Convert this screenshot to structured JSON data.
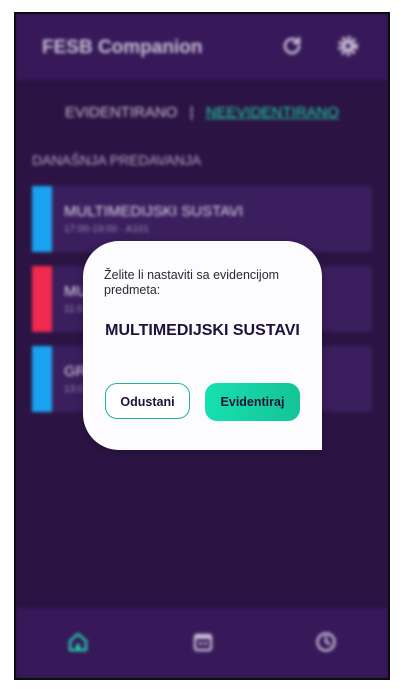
{
  "app": {
    "title": "FESB Companion",
    "icons": {
      "refresh": "refresh-icon",
      "settings": "gear-icon"
    }
  },
  "tabs": [
    {
      "label": "EVIDENTIRANO",
      "active": false
    },
    {
      "label": "NEEVIDENTIRANO",
      "active": true
    }
  ],
  "tab_separator": "|",
  "section_title": "DANAŠNJA PREDAVANJA",
  "lectures": [
    {
      "title": "MULTIMEDIJSKI SUSTAVI",
      "subtitle": "17:00-19:00 · A101",
      "color": "#1aa3f0"
    },
    {
      "title": "MU",
      "subtitle": "11:0",
      "color": "#f02a4e"
    },
    {
      "title": "GR",
      "subtitle": "13:0",
      "color": "#1aa3f0"
    }
  ],
  "dialog": {
    "message": "Želite li nastaviti sa evidencijom predmeta:",
    "subject": "MULTIMEDIJSKI SUSTAVI",
    "cancel_label": "Odustani",
    "confirm_label": "Evidentiraj"
  },
  "bottom_nav": [
    {
      "icon": "home-icon",
      "active": true
    },
    {
      "icon": "calendar-icon",
      "active": false
    },
    {
      "icon": "clock-icon",
      "active": false
    }
  ],
  "colors": {
    "accent": "#1fd3a8",
    "background": "#2b1444",
    "surface": "#3a1e5d"
  }
}
